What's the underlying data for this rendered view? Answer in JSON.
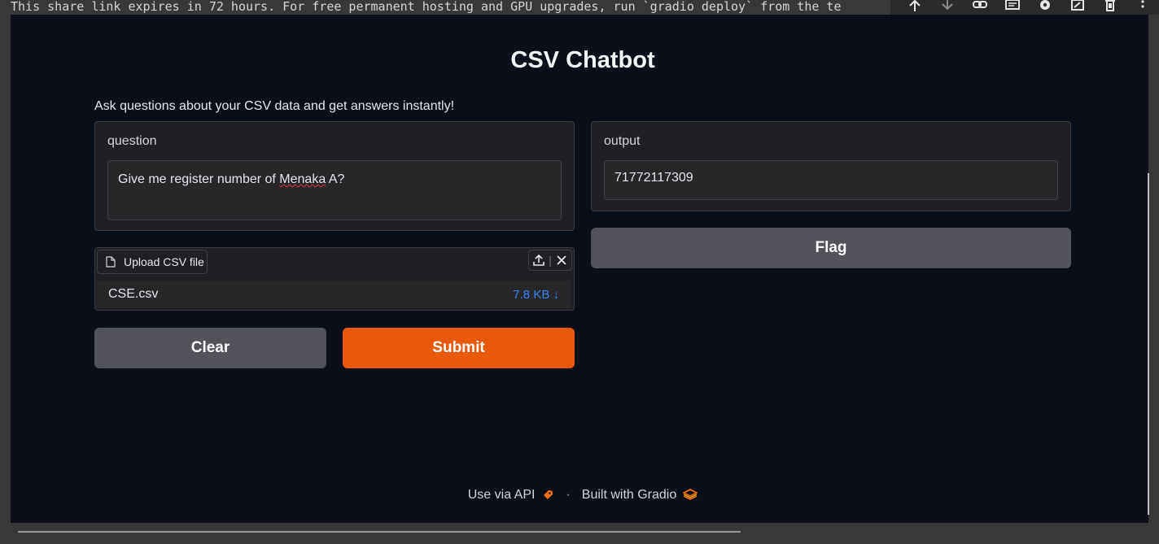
{
  "notebook_message": "This share link expires in 72 hours. For free permanent hosting and GPU upgrades, run `gradio deploy` from the te",
  "toolbar_icons": [
    "arrow-up-icon",
    "arrow-down-icon",
    "link-icon",
    "comment-icon",
    "gear-icon",
    "edit-icon",
    "trash-icon",
    "more-icon"
  ],
  "app": {
    "title": "CSV Chatbot",
    "description": "Ask questions about your CSV data and get answers instantly!"
  },
  "question": {
    "label": "question",
    "value_before": "Give me register number of ",
    "value_misspelled": "Menaka",
    "value_after": " A?"
  },
  "output": {
    "label": "output",
    "value": "71772117309"
  },
  "file_upload": {
    "label": "Upload CSV file",
    "file_name": "CSE.csv",
    "file_size": "7.8 KB ↓"
  },
  "buttons": {
    "clear": "Clear",
    "submit": "Submit",
    "flag": "Flag"
  },
  "footer": {
    "api_link": "Use via API",
    "separator": "·",
    "built_with": "Built with Gradio"
  },
  "colors": {
    "primary": "#ea580c",
    "secondary": "#52525b",
    "background": "#0b0f19",
    "link": "#3b82f6"
  }
}
